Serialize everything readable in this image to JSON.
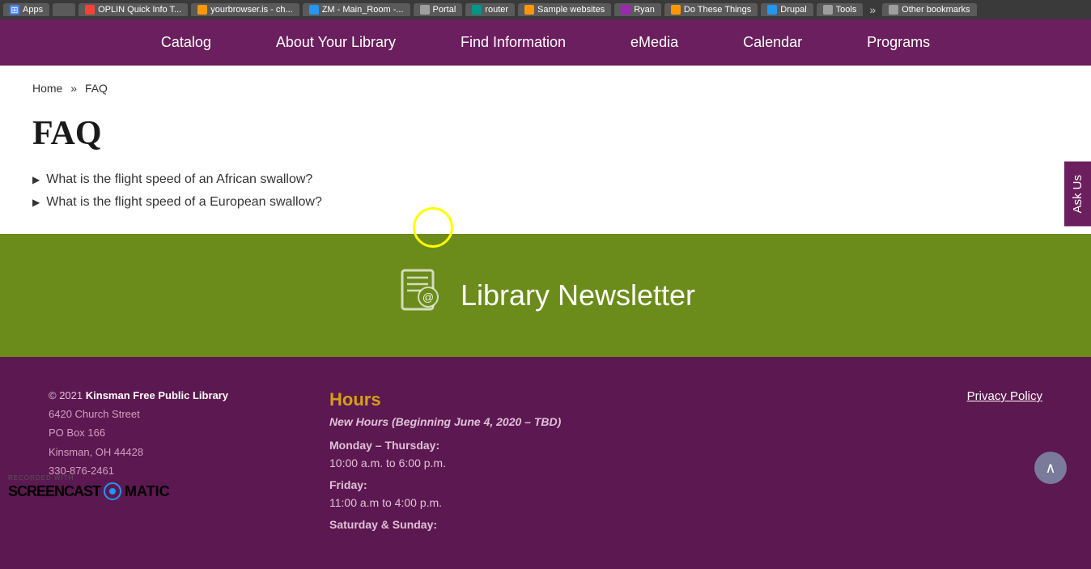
{
  "browser": {
    "tabs": [
      {
        "id": "apps",
        "label": "Apps",
        "icon_color": "apps",
        "active": false
      },
      {
        "id": "globe",
        "label": "",
        "icon_color": "globe",
        "active": false
      },
      {
        "id": "oplin",
        "label": "OPLIN Quick Info T...",
        "icon_color": "oplin",
        "active": false
      },
      {
        "id": "browser",
        "label": "yourbrowser.is - ch...",
        "icon_color": "browser",
        "active": false
      },
      {
        "id": "zoom",
        "label": "ZM - Main_Room -...",
        "icon_color": "zoom",
        "active": false
      },
      {
        "id": "portal",
        "label": "Portal",
        "icon_color": "portal",
        "active": false
      },
      {
        "id": "router",
        "label": "router",
        "icon_color": "router",
        "active": false
      },
      {
        "id": "sample",
        "label": "Sample websites",
        "icon_color": "sample",
        "active": false
      },
      {
        "id": "ryan",
        "label": "Ryan",
        "icon_color": "ryan",
        "active": false
      },
      {
        "id": "dothese",
        "label": "Do These Things",
        "icon_color": "dothese",
        "active": false
      },
      {
        "id": "drupal",
        "label": "Drupal",
        "icon_color": "drupal",
        "active": false
      },
      {
        "id": "tools",
        "label": "Tools",
        "icon_color": "tools",
        "active": false
      },
      {
        "id": "more",
        "label": "»",
        "icon_color": "",
        "active": false
      },
      {
        "id": "other",
        "label": "Other bookmarks",
        "icon_color": "gray",
        "active": false
      }
    ]
  },
  "nav": {
    "items": [
      {
        "id": "catalog",
        "label": "Catalog"
      },
      {
        "id": "about",
        "label": "About Your Library"
      },
      {
        "id": "find",
        "label": "Find Information"
      },
      {
        "id": "emedia",
        "label": "eMedia"
      },
      {
        "id": "calendar",
        "label": "Calendar"
      },
      {
        "id": "programs",
        "label": "Programs"
      }
    ]
  },
  "ask_us": {
    "label": "Ask Us"
  },
  "breadcrumb": {
    "home": "Home",
    "separator": "»",
    "current": "FAQ"
  },
  "faq": {
    "title": "FAQ",
    "items": [
      {
        "id": "q1",
        "text": "What is the flight speed of an African swallow?"
      },
      {
        "id": "q2",
        "text": "What is the flight speed of a European swallow?"
      }
    ]
  },
  "newsletter": {
    "title": "Library Newsletter",
    "icon": "📓"
  },
  "footer": {
    "copyright_year": "© 2021",
    "library_name": "Kinsman Free Public Library",
    "address_line1": "6420 Church Street",
    "address_line2": "PO Box 166",
    "address_line3": "Kinsman, OH 44428",
    "phone": "330-876-2461",
    "hours_title": "Hours",
    "hours_note": "New Hours (Beginning June 4, 2020 – TBD)",
    "hours_rows": [
      {
        "days": "Monday – Thursday:",
        "times": "10:00 a.m. to 6:00 p.m."
      },
      {
        "days": "Friday:",
        "times": "11:00 a.m to 4:00 p.m."
      },
      {
        "days": "Saturday & Sunday:",
        "times": ""
      }
    ],
    "privacy_policy": "Privacy Policy"
  },
  "screencast": {
    "recorded_with": "RECORDED WITH",
    "screencast": "SCREENCAST",
    "matic": "MATIC"
  }
}
